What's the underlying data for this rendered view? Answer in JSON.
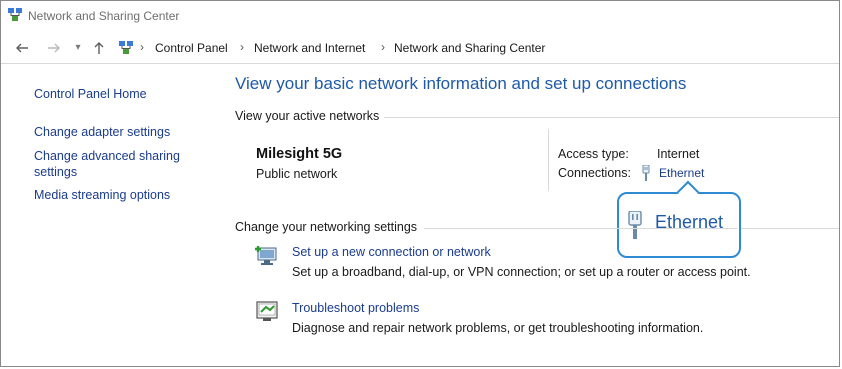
{
  "window": {
    "title": "Network and Sharing Center"
  },
  "nav": {
    "back_icon": "arrow-left-icon",
    "forward_icon": "arrow-right-icon",
    "up_icon": "arrow-up-icon",
    "breadcrumb": [
      "Control Panel",
      "Network and Internet",
      "Network and Sharing Center"
    ]
  },
  "sidebar": {
    "items": [
      {
        "label": "Control Panel Home"
      },
      {
        "label": "Change adapter settings"
      },
      {
        "label": "Change advanced sharing settings"
      },
      {
        "label": "Media streaming options"
      }
    ]
  },
  "main": {
    "title": "View your basic network information and set up connections",
    "active_networks_label": "View your active networks",
    "network": {
      "name": "Milesight 5G",
      "type": "Public network",
      "access_type_label": "Access type:",
      "access_type_value": "Internet",
      "connections_label": "Connections:",
      "connections_value": "Ethernet"
    },
    "callout_label": "Ethernet",
    "change_settings_label": "Change your networking settings",
    "tasks": [
      {
        "title": "Set up a new connection or network",
        "description": "Set up a broadband, dial-up, or VPN connection; or set up a router or access point."
      },
      {
        "title": "Troubleshoot problems",
        "description": "Diagnose and repair network problems, or get troubleshooting information."
      }
    ]
  },
  "colors": {
    "link": "#1a3c8c",
    "heading": "#1e5aa8",
    "callout_border": "#2e8bd1"
  }
}
